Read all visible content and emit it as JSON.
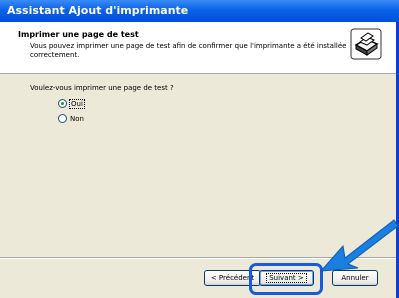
{
  "window": {
    "title": "Assistant Ajout d'imprimante",
    "titlebar_color": "#0a62e8"
  },
  "header": {
    "title": "Imprimer une page de test",
    "subtitle": "Vous pouvez imprimer une page de test afin de confirmer que l'imprimante a été installée correctement.",
    "icon": "printer-icon"
  },
  "body": {
    "question": "Voulez-vous imprimer une page de test ?",
    "options": [
      {
        "label": "Oui",
        "selected": true
      },
      {
        "label": "Non",
        "selected": false
      }
    ]
  },
  "footer": {
    "back_label": "< Précédent",
    "next_label": "Suivant >",
    "cancel_label": "Annuler"
  },
  "annotation": {
    "highlight_color": "#1a5adf",
    "pointer": "arrow-icon"
  }
}
